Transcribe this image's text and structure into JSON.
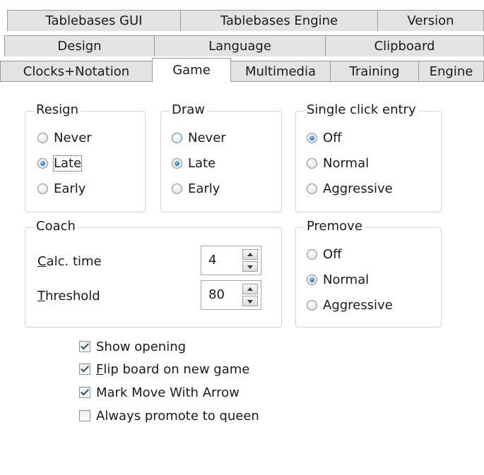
{
  "tabs": {
    "row1": [
      "Tablebases GUI",
      "Tablebases Engine",
      "Version"
    ],
    "row2": [
      "Design",
      "Language",
      "Clipboard"
    ],
    "row3": [
      "Clocks+Notation",
      "Game",
      "Multimedia",
      "Training",
      "Engine"
    ],
    "active": "Game"
  },
  "resign": {
    "title": "Resign",
    "options": [
      "Never",
      "Late",
      "Early"
    ],
    "selected": "Late"
  },
  "draw": {
    "title": "Draw",
    "options": [
      "Never",
      "Late",
      "Early"
    ],
    "selected": "Late"
  },
  "single_click": {
    "title": "Single click entry",
    "options": [
      "Off",
      "Normal",
      "Aggressive"
    ],
    "selected": "Off"
  },
  "coach": {
    "title": "Coach",
    "calc_time_label_u": "C",
    "calc_time_label_rest": "alc. time",
    "calc_time_value": "4",
    "threshold_label_u": "T",
    "threshold_label_rest": "hreshold",
    "threshold_value": "80"
  },
  "premove": {
    "title": "Premove",
    "options": [
      "Off",
      "Normal",
      "Aggressive"
    ],
    "selected": "Normal"
  },
  "checks": {
    "show_opening": {
      "label": "Show opening",
      "checked": true
    },
    "flip_board_u": "F",
    "flip_board_rest": "lip board on new game",
    "flip_board_checked": true,
    "mark_move": {
      "label": "Mark Move With Arrow",
      "checked": true
    },
    "promote_queen": {
      "label": "Always promote to queen",
      "checked": false
    }
  }
}
